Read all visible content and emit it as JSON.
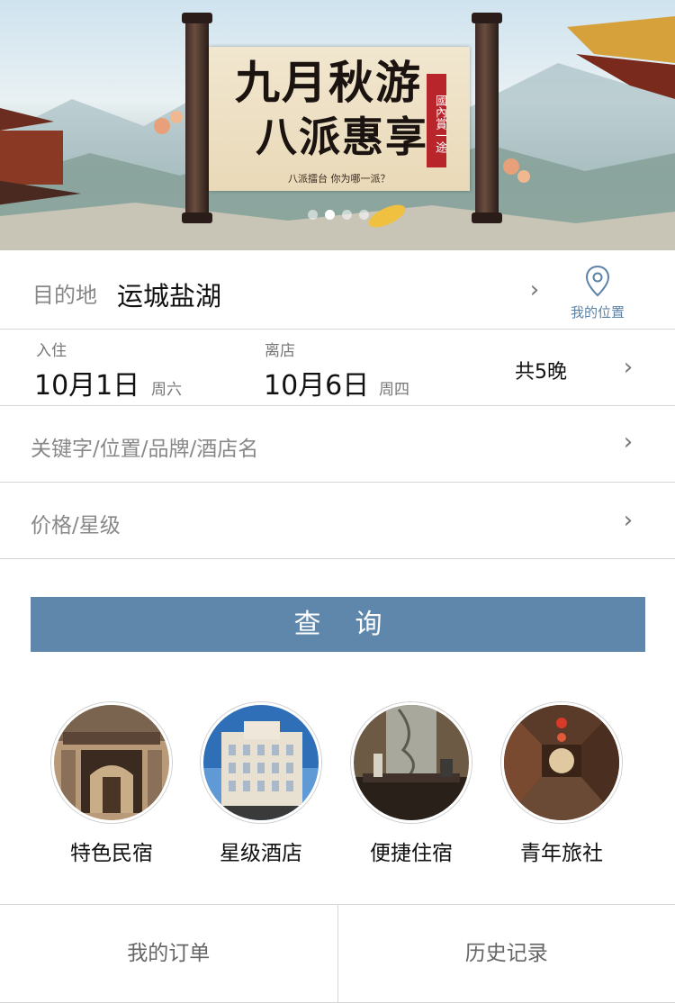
{
  "banner": {
    "title_line1": "九月秋游",
    "title_line2": "八派惠享",
    "tag": "國內賞一途",
    "subtitle": "八派擂台 你为哪一派？",
    "slide_count": 4,
    "active_slide": 2
  },
  "destination": {
    "label": "目的地",
    "value": "运城盐湖",
    "location_label": "我的位置"
  },
  "dates": {
    "checkin_label": "入住",
    "checkin_date": "10月1日",
    "checkin_weekday": "周六",
    "checkout_label": "离店",
    "checkout_date": "10月6日",
    "checkout_weekday": "周四",
    "nights": "共5晚"
  },
  "keyword": {
    "placeholder": "关键字/位置/品牌/酒店名"
  },
  "price": {
    "placeholder": "价格/星级"
  },
  "search_button": "查询",
  "categories": [
    {
      "label": "特色民宿",
      "icon": "folk-house-photo"
    },
    {
      "label": "星级酒店",
      "icon": "star-hotel-photo"
    },
    {
      "label": "便捷住宿",
      "icon": "budget-hotel-photo"
    },
    {
      "label": "青年旅社",
      "icon": "hostel-photo"
    }
  ],
  "bottom_tabs": [
    {
      "label": "我的订单"
    },
    {
      "label": "历史记录"
    }
  ],
  "colors": {
    "accent": "#5f87ab",
    "location_text": "#5b82a7",
    "divider": "#d6d6d6"
  }
}
